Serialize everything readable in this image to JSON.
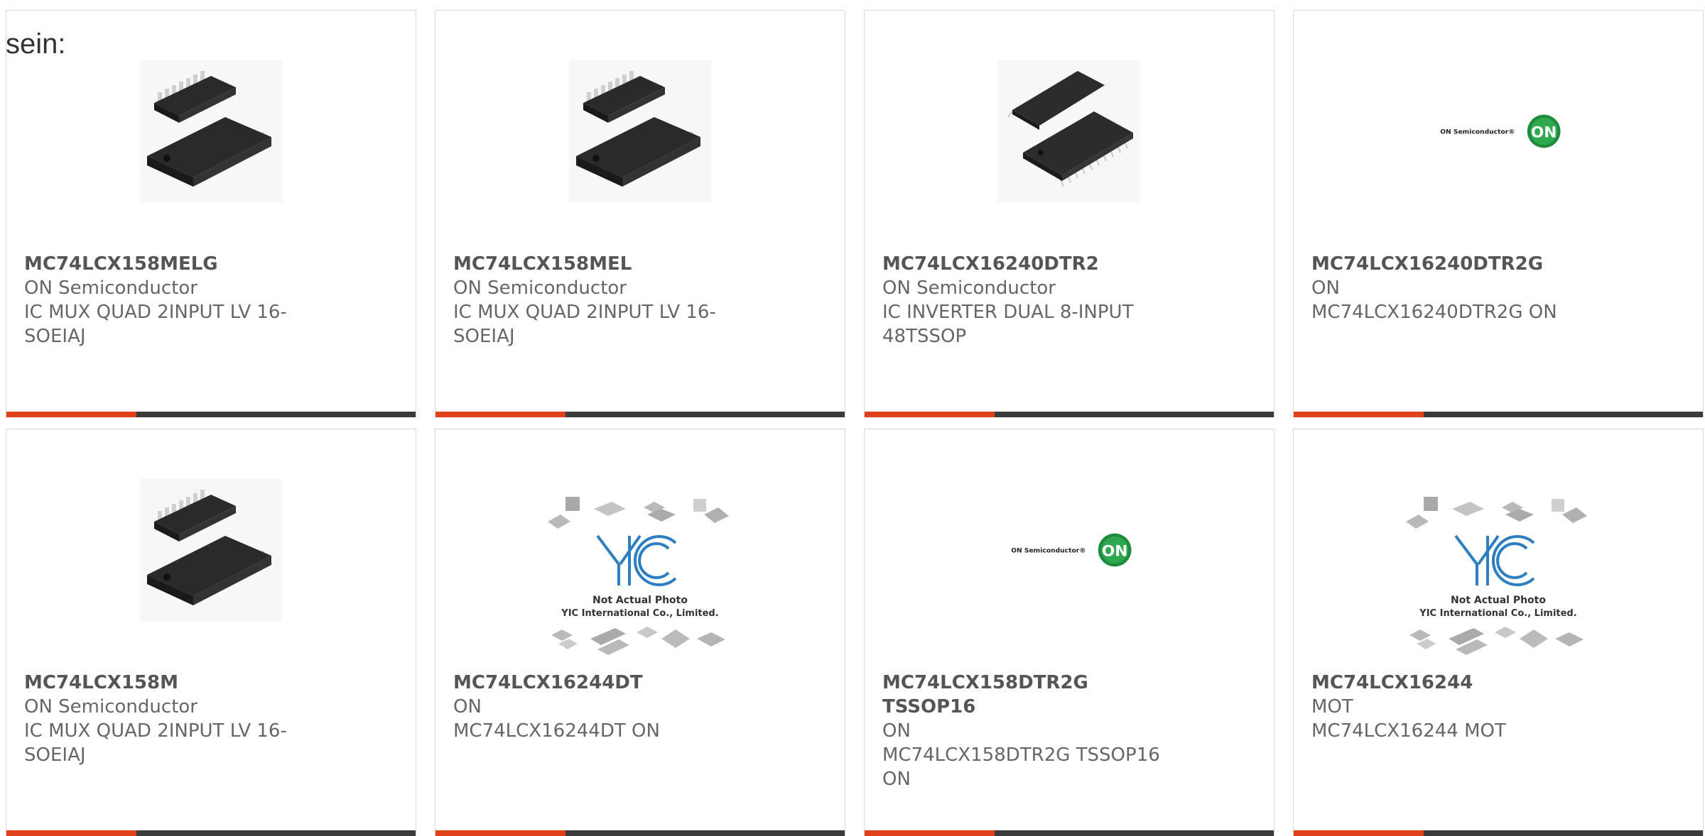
{
  "lead_text": "sein:",
  "products": [
    {
      "part_number": "MC74LCX158MELG",
      "manufacturer": "ON Semiconductor",
      "description": "IC MUX QUAD 2INPUT LV 16-SOEIAJ",
      "image": "soic-chip-photo"
    },
    {
      "part_number": "MC74LCX158MEL",
      "manufacturer": "ON Semiconductor",
      "description": "IC MUX QUAD 2INPUT LV 16-SOEIAJ",
      "image": "soic-chip-photo"
    },
    {
      "part_number": "MC74LCX16240DTR2",
      "manufacturer": "ON Semiconductor",
      "description": "IC INVERTER DUAL 8-INPUT 48TSSOP",
      "image": "tssop-chip-photo"
    },
    {
      "part_number": "MC74LCX16240DTR2G",
      "manufacturer": "ON",
      "description": "MC74LCX16240DTR2G ON",
      "image": "on-semiconductor-logo"
    },
    {
      "part_number": "MC74LCX158M",
      "manufacturer": "ON Semiconductor",
      "description": "IC MUX QUAD 2INPUT LV 16-SOEIAJ",
      "image": "soic-chip-photo"
    },
    {
      "part_number": "MC74LCX16244DT",
      "manufacturer": "ON",
      "description": "MC74LCX16244DT ON",
      "image": "yic-placeholder"
    },
    {
      "part_number": "MC74LCX158DTR2G TSSOP16",
      "manufacturer": "ON",
      "description": "MC74LCX158DTR2G TSSOP16 ON",
      "image": "on-semiconductor-logo"
    },
    {
      "part_number": "MC74LCX16244",
      "manufacturer": "MOT",
      "description": "MC74LCX16244 MOT",
      "image": "yic-placeholder"
    }
  ],
  "logo_text": {
    "on_semi": "ON Semiconductor®",
    "on_badge": "ON"
  },
  "placeholder_text": {
    "line1": "Not Actual Photo",
    "line2": "YIC International Co., Limited."
  },
  "colors": {
    "accent": "#e0401a",
    "bar": "#3b3b3b",
    "card_border": "#d7d7d7",
    "on_green": "#1e8a3c",
    "yic_blue": "#2d7fc1"
  }
}
